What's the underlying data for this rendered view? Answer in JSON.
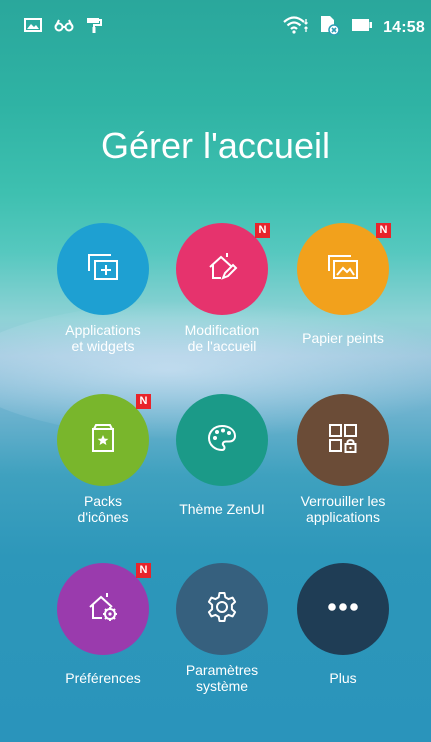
{
  "status_bar": {
    "left_icons": [
      "picture-icon",
      "glasses-icon",
      "paint-roller-icon"
    ],
    "right_icons": [
      "wifi-icon",
      "sim-card-icon",
      "battery-icon"
    ],
    "time": "14:58"
  },
  "page": {
    "title": "Gérer l'accueil"
  },
  "tiles": [
    {
      "label_line1": "Applications",
      "label_line2": "et widgets",
      "icon": "add-widget-icon",
      "color": "#1ea0d2",
      "badge": ""
    },
    {
      "label_line1": "Modification",
      "label_line2": "de l'accueil",
      "icon": "home-edit-icon",
      "color": "#e6336d",
      "badge": "N"
    },
    {
      "label_line1": "Papier peints",
      "label_line2": "",
      "icon": "wallpaper-icon",
      "color": "#f2a11c",
      "badge": "N"
    },
    {
      "label_line1": "Packs",
      "label_line2": "d'icônes",
      "icon": "icon-pack-icon",
      "color": "#79b62c",
      "badge": "N"
    },
    {
      "label_line1": "Thème ZenUI",
      "label_line2": "",
      "icon": "palette-icon",
      "color": "#1b9a88",
      "badge": ""
    },
    {
      "label_line1": "Verrouiller les",
      "label_line2": "applications",
      "icon": "app-lock-icon",
      "color": "#6b4c37",
      "badge": ""
    },
    {
      "label_line1": "Préférences",
      "label_line2": "",
      "icon": "home-settings-icon",
      "color": "#9a3bad",
      "badge": "N"
    },
    {
      "label_line1": "Paramètres",
      "label_line2": "système",
      "icon": "gear-icon",
      "color": "#36607e",
      "badge": ""
    },
    {
      "label_line1": "Plus",
      "label_line2": "",
      "icon": "more-dots-icon",
      "color": "#1f3d55",
      "badge": ""
    }
  ]
}
